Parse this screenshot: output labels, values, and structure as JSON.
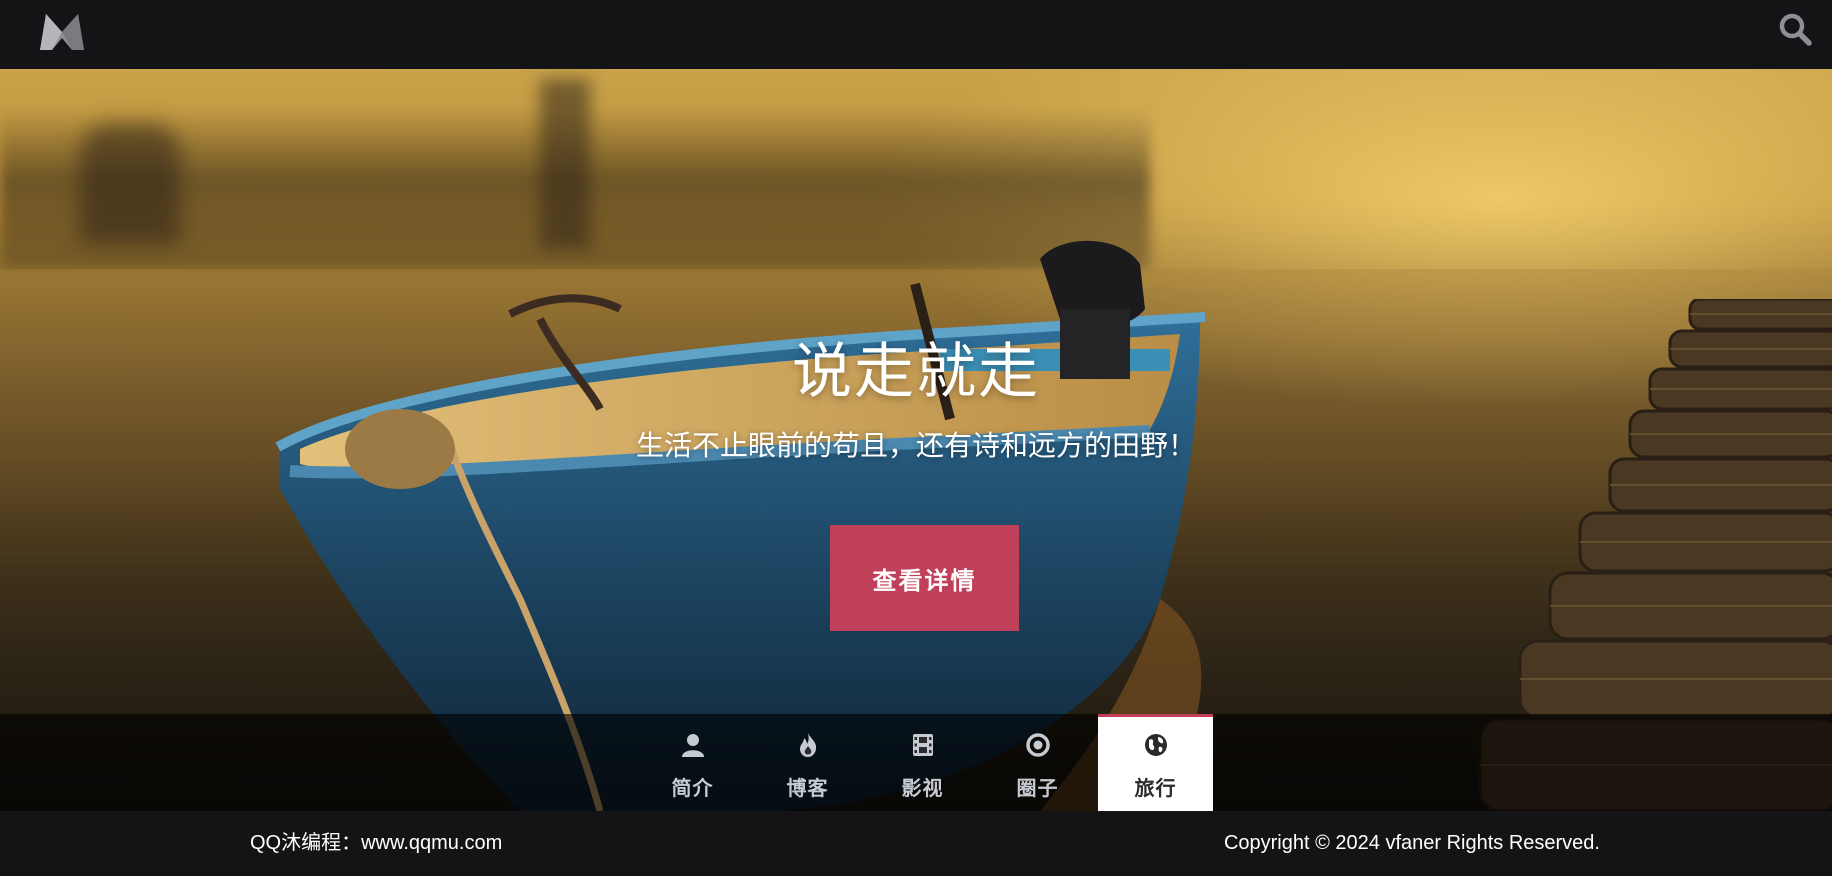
{
  "header": {
    "logo_icon": "m-logo-icon",
    "search_icon": "search-icon"
  },
  "hero": {
    "title": "说走就走",
    "subtitle": "生活不止眼前的苟且，还有诗和远方的田野！",
    "cta_label": "查看详情"
  },
  "nav": {
    "items": [
      {
        "label": "简介",
        "icon": "user-icon"
      },
      {
        "label": "博客",
        "icon": "fire-icon"
      },
      {
        "label": "影视",
        "icon": "film-icon"
      },
      {
        "label": "圈子",
        "icon": "circle-dot-icon"
      },
      {
        "label": "旅行",
        "icon": "globe-icon",
        "active": true
      }
    ]
  },
  "footer": {
    "left": "QQ沐编程：www.qqmu.com",
    "right": "Copyright © 2024 vfaner Rights Reserved."
  },
  "colors": {
    "accent": "#c0405a",
    "background": "#141417",
    "nav_text": "#c6cad1"
  }
}
